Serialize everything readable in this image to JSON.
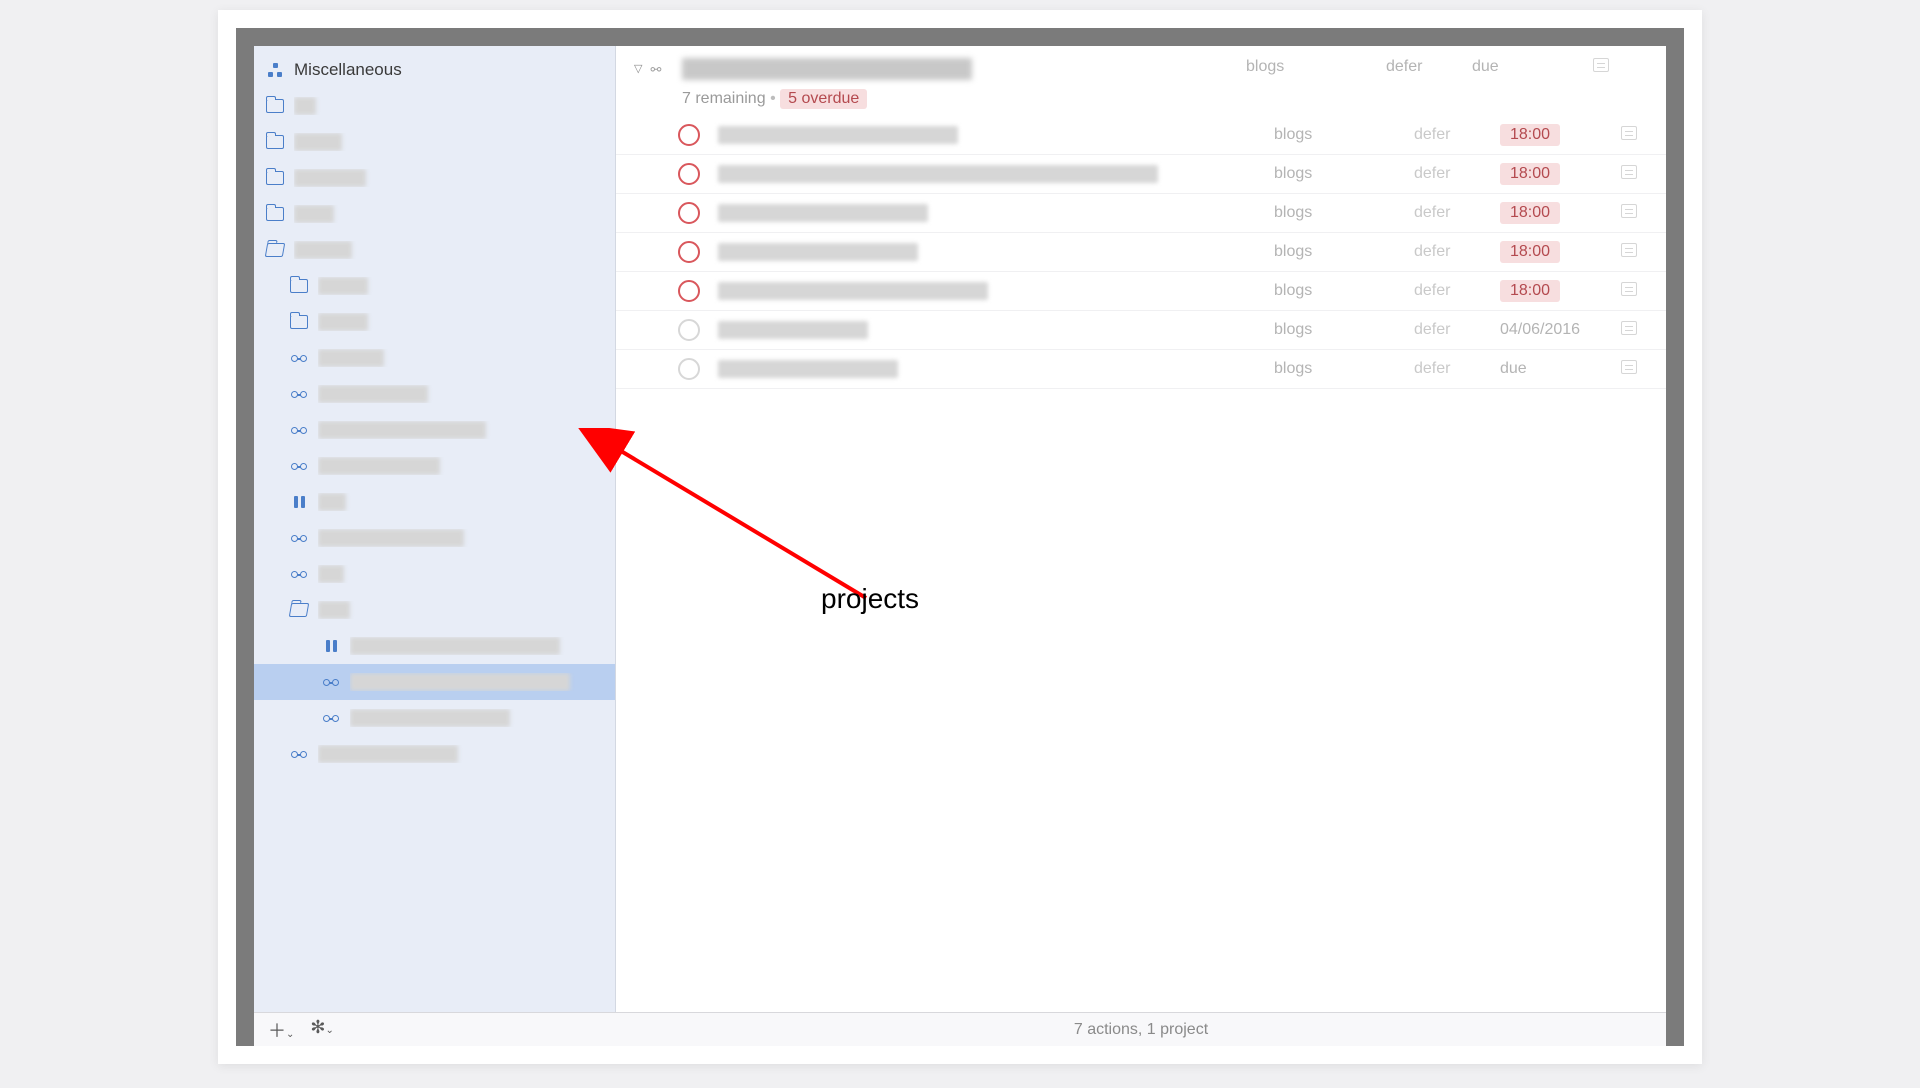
{
  "sidebar": {
    "title": "Miscellaneous",
    "items": [
      {
        "icon": "misc",
        "indent": 0,
        "label": "Miscellaneous",
        "showLabel": true,
        "blurW": 0
      },
      {
        "icon": "folder",
        "indent": 0,
        "blurW": 22
      },
      {
        "icon": "folder",
        "indent": 0,
        "blurW": 48
      },
      {
        "icon": "folder",
        "indent": 0,
        "blurW": 72
      },
      {
        "icon": "folder",
        "indent": 0,
        "blurW": 40
      },
      {
        "icon": "folder-open",
        "indent": 0,
        "blurW": 58
      },
      {
        "icon": "folder",
        "indent": 1,
        "blurW": 50
      },
      {
        "icon": "folder",
        "indent": 1,
        "blurW": 50
      },
      {
        "icon": "seq",
        "indent": 1,
        "blurW": 66
      },
      {
        "icon": "seq",
        "indent": 1,
        "blurW": 110
      },
      {
        "icon": "seq",
        "indent": 1,
        "blurW": 168
      },
      {
        "icon": "seq",
        "indent": 1,
        "blurW": 122
      },
      {
        "icon": "pause",
        "indent": 1,
        "blurW": 28
      },
      {
        "icon": "seq",
        "indent": 1,
        "blurW": 146
      },
      {
        "icon": "seq",
        "indent": 1,
        "blurW": 26
      },
      {
        "icon": "folder-open",
        "indent": 1,
        "blurW": 32
      },
      {
        "icon": "pause",
        "indent": 2,
        "blurW": 210
      },
      {
        "icon": "seq",
        "indent": 2,
        "blurW": 220,
        "selected": true
      },
      {
        "icon": "seq",
        "indent": 2,
        "blurW": 160
      },
      {
        "icon": "seq",
        "indent": 1,
        "blurW": 140
      }
    ]
  },
  "project": {
    "remaining_text": "7 remaining",
    "overdue_text": "5 overdue",
    "cols": {
      "context": "blogs",
      "defer": "defer",
      "due": "due"
    }
  },
  "tasks": [
    {
      "overdue": true,
      "titleW": 240,
      "context": "blogs",
      "defer": "defer",
      "due": "18:00",
      "duePill": true
    },
    {
      "overdue": true,
      "titleW": 440,
      "context": "blogs",
      "defer": "defer",
      "due": "18:00",
      "duePill": true
    },
    {
      "overdue": true,
      "titleW": 210,
      "context": "blogs",
      "defer": "defer",
      "due": "18:00",
      "duePill": true
    },
    {
      "overdue": true,
      "titleW": 200,
      "context": "blogs",
      "defer": "defer",
      "due": "18:00",
      "duePill": true
    },
    {
      "overdue": true,
      "titleW": 270,
      "context": "blogs",
      "defer": "defer",
      "due": "18:00",
      "duePill": true
    },
    {
      "overdue": false,
      "titleW": 150,
      "context": "blogs",
      "defer": "defer",
      "due": "04/06/2016",
      "duePill": false
    },
    {
      "overdue": false,
      "titleW": 180,
      "context": "blogs",
      "defer": "defer",
      "due": "due",
      "duePill": false
    }
  ],
  "statusbar": "7 actions, 1 project",
  "annotation": {
    "label": "projects"
  }
}
